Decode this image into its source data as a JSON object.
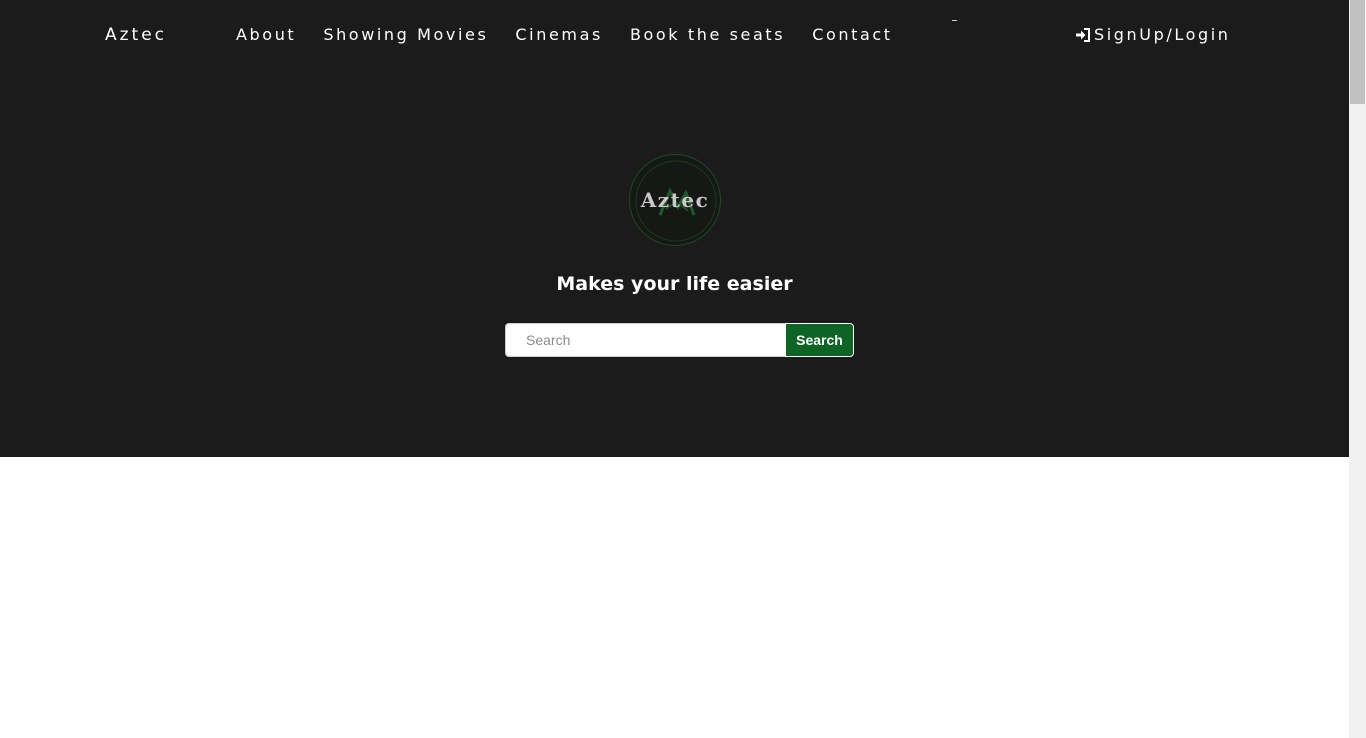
{
  "nav": {
    "brand": "Aztec",
    "links": [
      {
        "label": "About"
      },
      {
        "label": "Showing Movies"
      },
      {
        "label": "Cinemas"
      },
      {
        "label": "Book the seats"
      },
      {
        "label": "Contact"
      }
    ],
    "login_label": "SignUp/Login",
    "login_icon": "sign-in-icon"
  },
  "hero": {
    "logo_text": "Aztec",
    "tagline": "Makes your life easier"
  },
  "search": {
    "placeholder": "Search",
    "value": "",
    "button_label": "Search"
  },
  "colors": {
    "hero_background": "#1b1b1b",
    "accent_green": "#0e6424",
    "text": "#ffffff"
  }
}
